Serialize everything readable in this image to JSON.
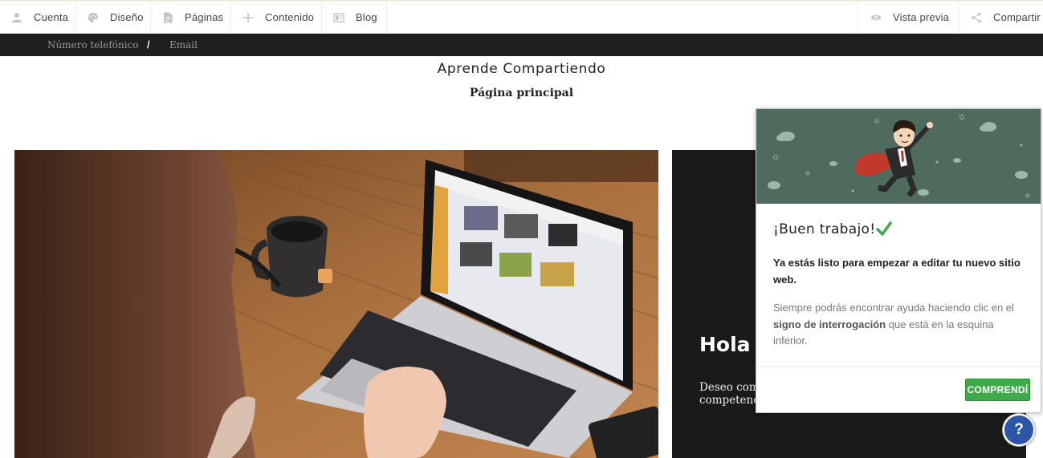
{
  "toolbar": {
    "cuenta": "Cuenta",
    "diseno": "Diseño",
    "paginas": "Páginas",
    "contenido": "Contenido",
    "blog": "Blog",
    "vista_previa": "Vista previa",
    "compartir": "Compartir"
  },
  "contact_bar": {
    "phone": "Número telefónico",
    "separator": "/",
    "email": "Email"
  },
  "site": {
    "title": "Aprende Compartiendo",
    "subtitle": "Página principal"
  },
  "hero": {
    "heading": "Hola b",
    "text_line1": "Deseo comp",
    "text_line2": "competenci"
  },
  "popup": {
    "title": "¡Buen trabajo!",
    "lead": "Ya estás listo para empezar a editar tu nuevo sitio web.",
    "body_pre": "Siempre podrás encontrar ayuda haciendo clic en el",
    "body_bold": "signo de interrogación",
    "body_post": "que está en la esquina inferior.",
    "button": "COMPRENDÍ",
    "check_color": "#3faa4a",
    "banner_color": "#4f6b5e"
  },
  "help": {
    "label": "?"
  },
  "colors": {
    "accent_green": "#3faa4a",
    "help_blue": "#2c56a8",
    "contact_bar_bg": "#1f1f1f"
  }
}
